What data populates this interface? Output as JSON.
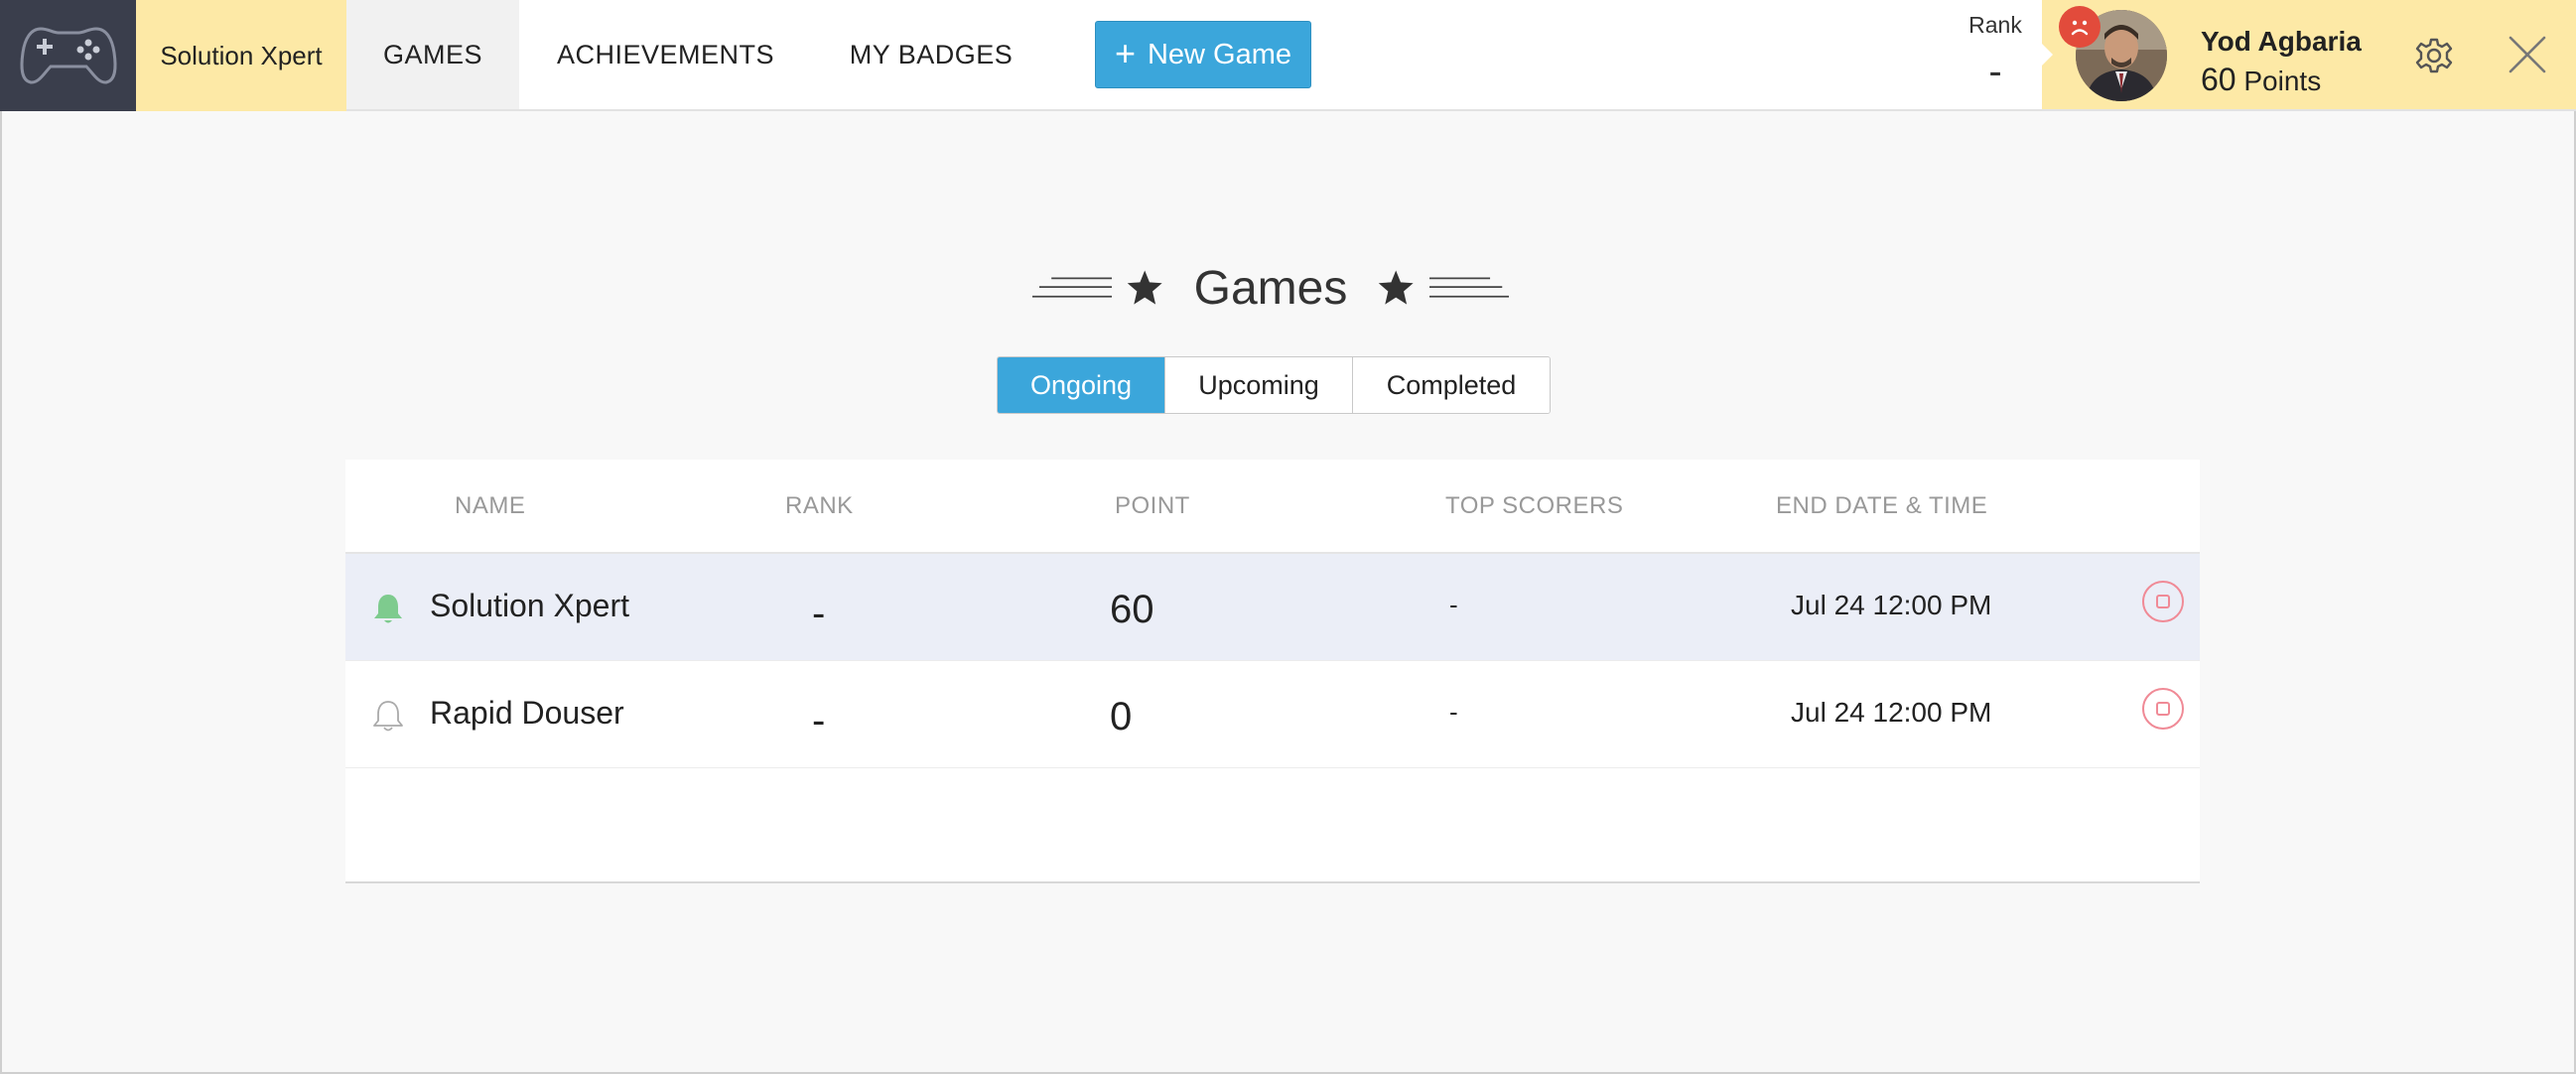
{
  "header": {
    "app_name": "Solution Xpert",
    "nav": {
      "games": "GAMES",
      "achievements": "ACHIEVEMENTS",
      "badges": "MY BADGES"
    },
    "new_game_label": "New Game",
    "rank_label": "Rank",
    "rank_value": "-",
    "user": {
      "name": "Yod Agbaria",
      "points_value": "60",
      "points_label": "Points"
    }
  },
  "main": {
    "title": "Games",
    "tabs": [
      {
        "label": "Ongoing",
        "active": true
      },
      {
        "label": "Upcoming",
        "active": false
      },
      {
        "label": "Completed",
        "active": false
      }
    ],
    "table": {
      "columns": [
        "NAME",
        "RANK",
        "POINT",
        "TOP SCORERS",
        "END DATE & TIME"
      ],
      "rows": [
        {
          "name": "Solution Xpert",
          "rank": "-",
          "point": "60",
          "top_scorers": "-",
          "end": "Jul 24 12:00 PM",
          "notify": true
        },
        {
          "name": "Rapid Douser",
          "rank": "-",
          "point": "0",
          "top_scorers": "-",
          "end": "Jul 24 12:00 PM",
          "notify": false
        }
      ]
    }
  },
  "colors": {
    "accent": "#3ba6db",
    "highlight": "#fde9a6",
    "logo_bg": "#3a3e4c",
    "bell_active": "#7ecb8e",
    "stop": "#f08a96",
    "sad": "#e24b3b"
  },
  "icons": [
    "gamepad-icon",
    "plus-icon",
    "sad-face-icon",
    "gear-icon",
    "close-icon",
    "star-icon",
    "bell-icon",
    "stop-icon"
  ]
}
